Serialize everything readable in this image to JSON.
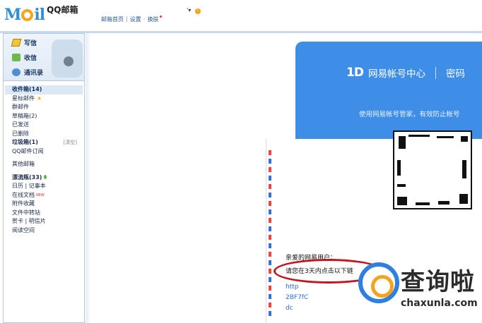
{
  "topbar": {
    "logo_text": "M il",
    "logo_suffix": "QQ邮箱",
    "links": [
      "邮箱首页",
      "设置",
      "换肤"
    ],
    "user_mark": "'▾",
    "user_badge": "!"
  },
  "sidebar": {
    "quick": [
      {
        "label": "写信",
        "icon": "pencil-icon"
      },
      {
        "label": "收信",
        "icon": "inbox-icon"
      },
      {
        "label": "通讯录",
        "icon": "contacts-icon"
      }
    ],
    "folders": {
      "inbox": "收件箱(14)",
      "starred": "星标邮件",
      "group": "群邮件",
      "drafts": "草稿箱(2)",
      "sent": "已发送",
      "deleted": "已删除",
      "spam": "垃圾箱(1)",
      "spam_action": "[清空]",
      "subscription": "QQ邮件订阅",
      "other": "其他邮箱",
      "drift": "漂流瓶(33)",
      "calendar": "日历",
      "notes": "记事本",
      "docs": "在线文档",
      "docs_badge": "NEW",
      "attachments": "附件收藏",
      "transfer": "文件中转站",
      "cards": "贺卡",
      "postcards": "明信片",
      "reading": "阅读空间"
    }
  },
  "main": {
    "banner": {
      "logo_mark": "1D",
      "title": "网易帐号中心",
      "extra": "密码",
      "tip": "使用网易帐号管家，有效防止帐号"
    },
    "greeting": "亲爱的网易用户：",
    "instruction": "请您在3天内点击以下链",
    "link_fragments": [
      "http",
      "2BF7fC",
      "dc"
    ]
  },
  "watermark": {
    "title": "查询啦",
    "url": "chaxunla.com"
  },
  "colors": {
    "brand_blue": "#3e8ee8",
    "highlight_red": "#c4161c",
    "link_blue": "#2d6bd6"
  }
}
